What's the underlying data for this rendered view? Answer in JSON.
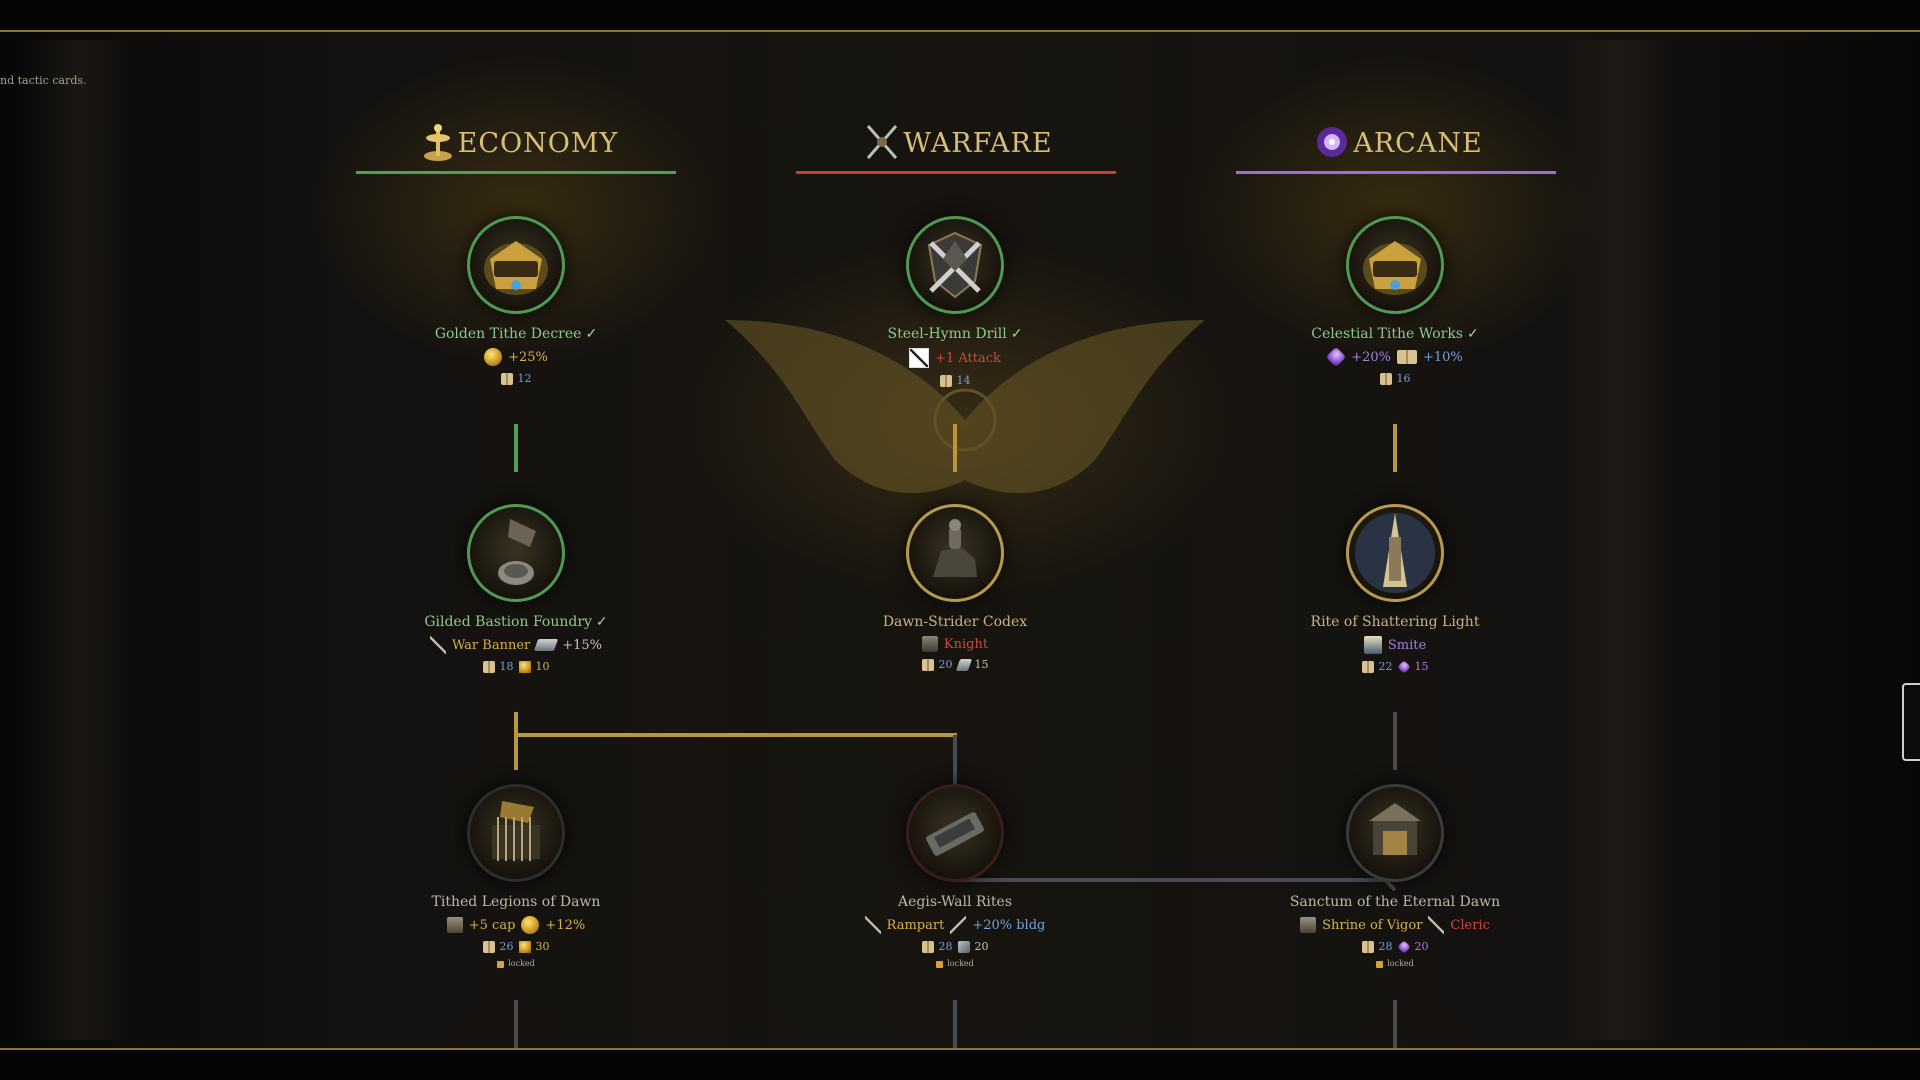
{
  "intro_fragment": "nd tactic cards.",
  "columns": [
    {
      "key": "economy",
      "title": "ECONOMY",
      "icon": "scales-icon",
      "accent": "#4fa055"
    },
    {
      "key": "warfare",
      "title": "WARFARE",
      "icon": "crossed-swords-icon",
      "accent": "#c8432f"
    },
    {
      "key": "arcane",
      "title": "ARCANE",
      "icon": "arcane-orb-icon",
      "accent": "#9a6fd6"
    }
  ],
  "nodes": {
    "economy": [
      {
        "name": "Golden Tithe Decree",
        "status": "researched",
        "check": "✓",
        "effects": [
          {
            "icon": "gold-coin-icon",
            "text": "+25%"
          }
        ],
        "cost": [
          {
            "icon": "book-icon",
            "value": "12"
          }
        ]
      },
      {
        "name": "Gilded Bastion Foundry",
        "status": "researched",
        "check": "✓",
        "effects": [
          {
            "icon": "war-banner-icon",
            "text": "War Banner"
          },
          {
            "icon": "iron-ingot-icon",
            "text": "+15%"
          }
        ],
        "cost": [
          {
            "icon": "book-icon",
            "value": "18"
          },
          {
            "icon": "gold-coin-icon",
            "value": "10"
          }
        ]
      },
      {
        "name": "Tithed Legions of Dawn",
        "status": "locked",
        "effects": [
          {
            "icon": "helmet-icon",
            "text": "+5 cap"
          },
          {
            "icon": "gold-coin-icon",
            "text": "+12%"
          }
        ],
        "cost": [
          {
            "icon": "book-icon",
            "value": "26"
          },
          {
            "icon": "gold-coin-icon",
            "value": "30"
          }
        ],
        "lock_label": "locked"
      }
    ],
    "warfare": [
      {
        "name": "Steel-Hymn Drill",
        "status": "researched",
        "check": "✓",
        "effects": [
          {
            "icon": "attack-icon",
            "text": "+1 Attack"
          }
        ],
        "cost": [
          {
            "icon": "book-icon",
            "value": "14"
          }
        ]
      },
      {
        "name": "Dawn-Strider Codex",
        "status": "available",
        "effects": [
          {
            "icon": "knight-icon",
            "text": "Knight"
          }
        ],
        "cost": [
          {
            "icon": "book-icon",
            "value": "20"
          },
          {
            "icon": "iron-ingot-icon",
            "value": "15"
          }
        ]
      },
      {
        "name": "Aegis-Wall Rites",
        "status": "locked",
        "effects": [
          {
            "icon": "rampart-icon",
            "text": "Rampart"
          },
          {
            "icon": "hammer-icon",
            "text": "+20% bldg"
          }
        ],
        "cost": [
          {
            "icon": "book-icon",
            "value": "28"
          },
          {
            "icon": "stone-icon",
            "value": "20"
          }
        ],
        "lock_label": "locked"
      }
    ],
    "arcane": [
      {
        "name": "Celestial Tithe Works",
        "status": "researched",
        "check": "✓",
        "effects": [
          {
            "icon": "mana-gem-icon",
            "text": "+20%"
          },
          {
            "icon": "book-icon",
            "text": "+10%"
          }
        ],
        "cost": [
          {
            "icon": "book-icon",
            "value": "16"
          }
        ]
      },
      {
        "name": "Rite of Shattering Light",
        "status": "available",
        "effects": [
          {
            "icon": "smite-icon",
            "text": "Smite"
          }
        ],
        "cost": [
          {
            "icon": "book-icon",
            "value": "22"
          },
          {
            "icon": "mana-gem-icon",
            "value": "15"
          }
        ]
      },
      {
        "name": "Sanctum of the Eternal Dawn",
        "status": "locked",
        "effects": [
          {
            "icon": "shrine-icon",
            "text": "Shrine of Vigor"
          },
          {
            "icon": "cleric-icon",
            "text": "Cleric"
          }
        ],
        "cost": [
          {
            "icon": "book-icon",
            "value": "28"
          },
          {
            "icon": "mana-gem-icon",
            "value": "20"
          }
        ],
        "lock_label": "locked"
      }
    ]
  },
  "colors": {
    "researched": "#8dc98b",
    "gold": "#d8be78",
    "locked_line": "#4a4a52",
    "gold_line": "#b8973f"
  }
}
